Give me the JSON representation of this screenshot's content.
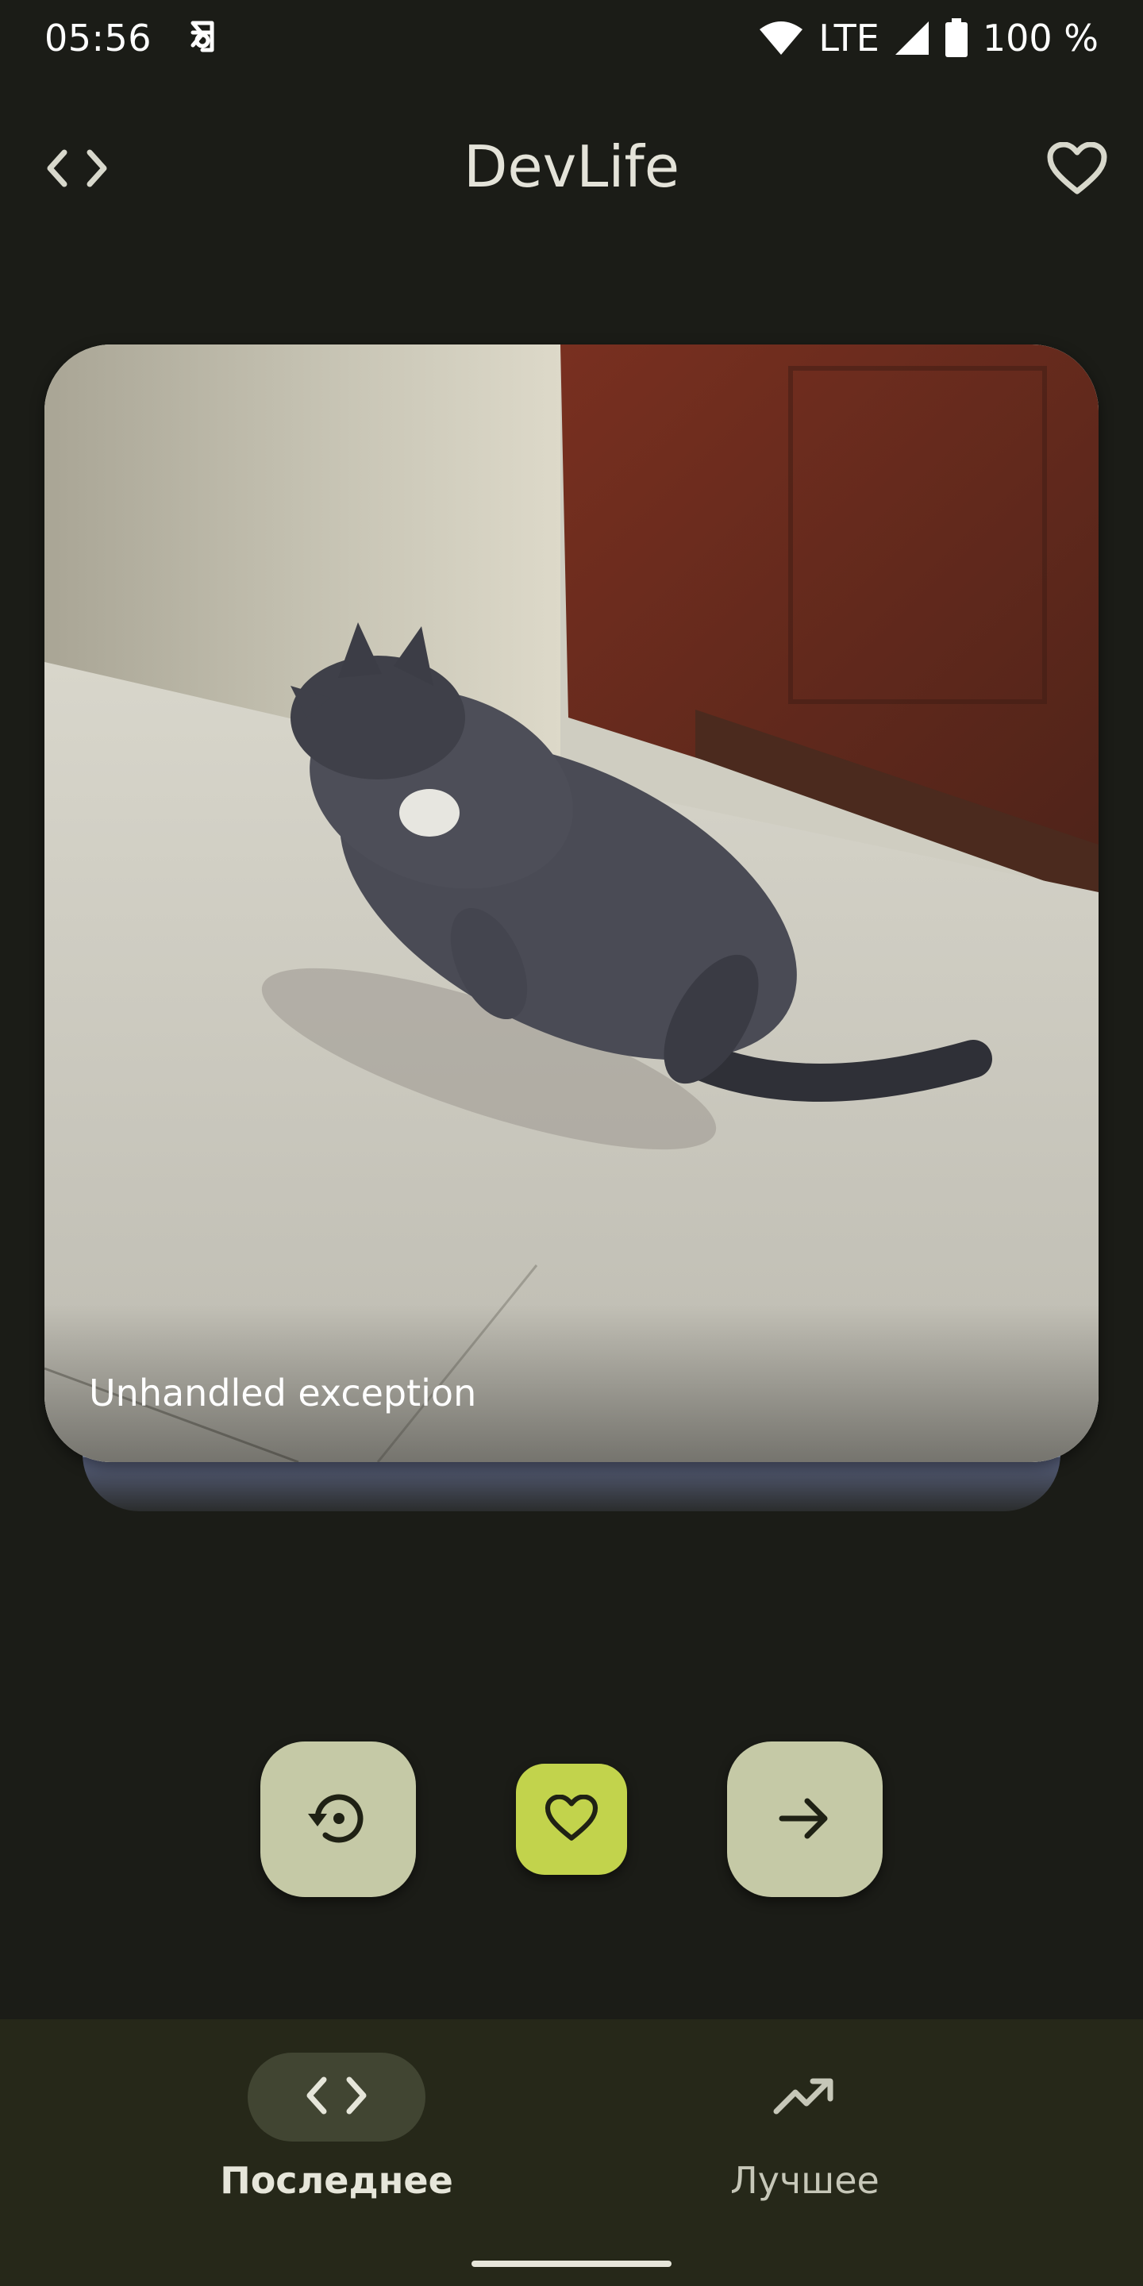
{
  "status_bar": {
    "time": "05:56",
    "network": "LTE",
    "battery": "100 %",
    "icons": [
      "notification-app-icon",
      "wifi-icon",
      "cell-signal-icon",
      "battery-icon"
    ]
  },
  "app_bar": {
    "title": "DevLife",
    "left_icon": "code-icon",
    "right_icon": "heart-outline-icon"
  },
  "post": {
    "caption": "Unhandled exception"
  },
  "actions": {
    "icons": [
      "restore-icon",
      "heart-icon",
      "arrow-forward-icon"
    ],
    "like_color": "#c2d34c",
    "button_color": "#c5c9a6"
  },
  "bottom_nav": {
    "items": [
      {
        "label": "Последнее",
        "icon": "code-icon",
        "selected": true
      },
      {
        "label": "Лучшее",
        "icon": "trending-up-icon",
        "selected": false
      }
    ]
  },
  "colors": {
    "background": "#1b1c17",
    "nav_background": "#262819",
    "nav_indicator": "#414532"
  }
}
